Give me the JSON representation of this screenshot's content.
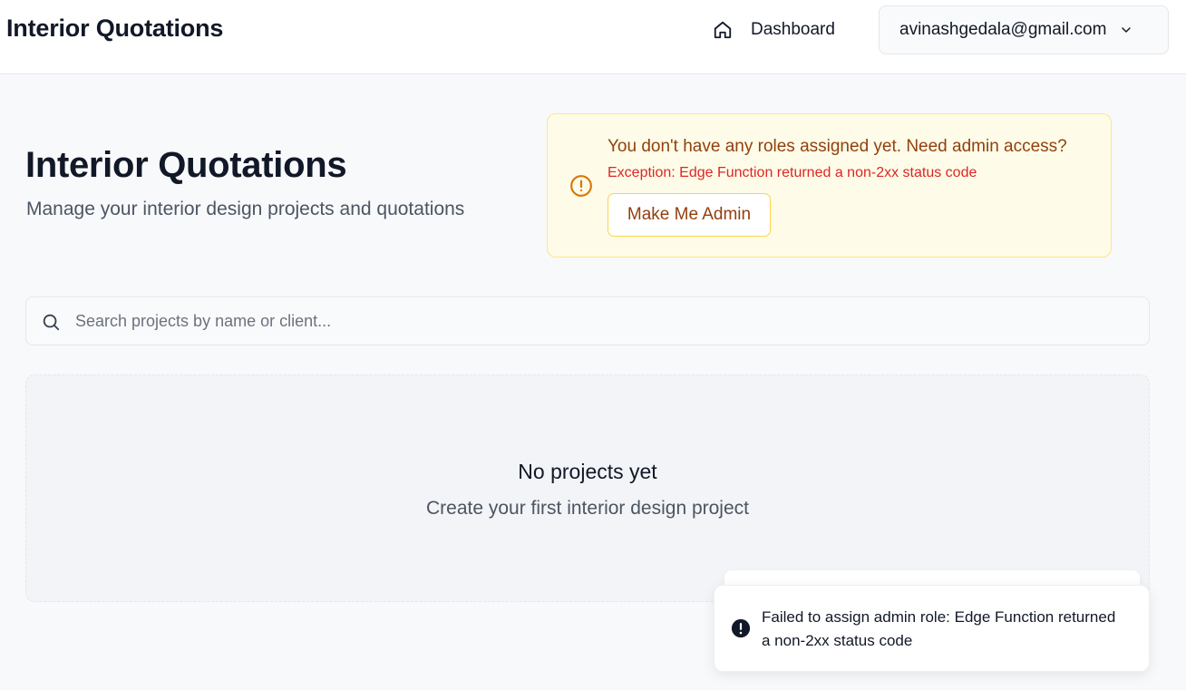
{
  "header": {
    "brand": "Interior Quotations",
    "nav_dashboard": "Dashboard",
    "user_email": "avinashgedala@gmail.com"
  },
  "page": {
    "title": "Interior Quotations",
    "subtitle": "Manage your interior design projects and quotations"
  },
  "alert": {
    "title": "You don't have any roles assigned yet. Need admin access?",
    "error": "Exception: Edge Function returned a non-2xx status code",
    "button_label": "Make Me Admin",
    "icon": "alert-circle-icon"
  },
  "search": {
    "placeholder": "Search projects by name or client...",
    "value": ""
  },
  "empty_state": {
    "title": "No projects yet",
    "subtitle": "Create your first interior design project"
  },
  "toast": {
    "message": "Failed to assign admin role: Edge Function returned a non-2xx status code",
    "icon": "error-circle-icon"
  },
  "colors": {
    "alert_bg": "#fefce8",
    "alert_border": "#fde68a",
    "alert_text": "#92400e",
    "error_text": "#dc2626",
    "page_bg": "#f8f9fb"
  }
}
